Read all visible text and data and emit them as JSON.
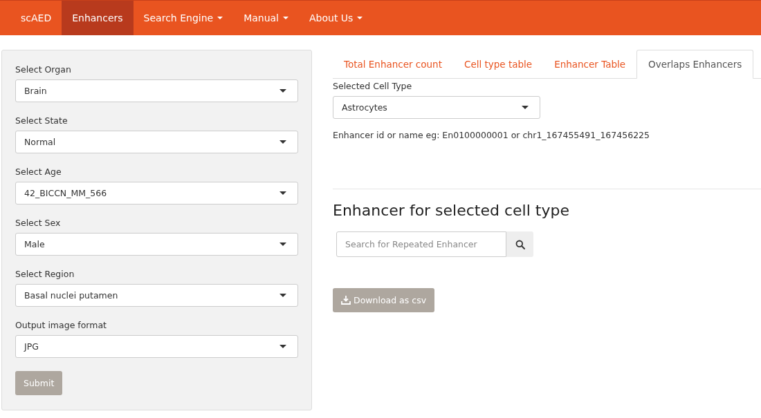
{
  "navbar": {
    "brand": "scAED",
    "items": [
      {
        "label": "Enhancers",
        "selected": true,
        "dropdown": false
      },
      {
        "label": "Search Engine",
        "selected": false,
        "dropdown": true
      },
      {
        "label": "Manual",
        "selected": false,
        "dropdown": true
      },
      {
        "label": "About Us",
        "selected": false,
        "dropdown": true
      }
    ]
  },
  "sidebar": {
    "fields": [
      {
        "label": "Select Organ",
        "value": "Brain"
      },
      {
        "label": "Select State",
        "value": "Normal"
      },
      {
        "label": "Select Age",
        "value": "42_BICCN_MM_566"
      },
      {
        "label": "Select Sex",
        "value": "Male"
      },
      {
        "label": "Select Region",
        "value": "Basal nuclei putamen"
      },
      {
        "label": "Output image format",
        "value": "JPG"
      }
    ],
    "submit": "Submit"
  },
  "tabs": [
    {
      "label": "Total Enhancer count",
      "selected": false
    },
    {
      "label": "Cell type table",
      "selected": false
    },
    {
      "label": "Enhancer Table",
      "selected": false
    },
    {
      "label": "Overlaps Enhancers",
      "selected": true
    }
  ],
  "cell_type": {
    "label": "Selected Cell Type",
    "value": "Astrocytes"
  },
  "hint": "Enhancer id or name eg: En0100000001 or chr1_167455491_167456225",
  "heading": "Enhancer for selected cell type",
  "search": {
    "placeholder": "Search for Repeated Enhancer"
  },
  "download_button": "Download as csv"
}
